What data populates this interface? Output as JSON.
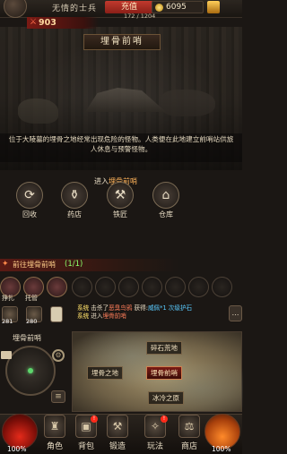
{
  "header": {
    "player_name": "无情的士兵",
    "vip_label": "充值",
    "coins": "6095",
    "hp_text": "172 / 1204",
    "power": "903"
  },
  "location": {
    "title": "埋骨前哨",
    "description": "位于大陵墓的埋骨之地经常出现危险的怪物。人类便在此地建立前哨站供旅人休息与预警怪物。"
  },
  "facilities": {
    "enter_prefix": "进入",
    "enter_name": "埋骨前哨",
    "items": [
      {
        "label": "回收",
        "icon": "recycle-icon"
      },
      {
        "label": "药店",
        "icon": "potion-icon"
      },
      {
        "label": "铁匠",
        "icon": "anvil-icon"
      },
      {
        "label": "仓库",
        "icon": "warehouse-icon"
      }
    ]
  },
  "quest": {
    "text": "前往埋骨前哨",
    "progress": "(1/1)"
  },
  "skills": {
    "labels": [
      "挣扎",
      "托管"
    ]
  },
  "items": [
    {
      "count": "281"
    },
    {
      "count": "280"
    }
  ],
  "log": [
    {
      "tag": "系统",
      "text1": "击杀了",
      "name": "恶臭鸟鸦",
      "text2": " 获得:",
      "item": "威佩*1",
      "text3": " 次级护石"
    },
    {
      "tag": "系统",
      "text1": "进入",
      "name": "埋骨前哨",
      "text2": "",
      "item": "",
      "text3": ""
    }
  ],
  "map": {
    "current_area": "埋骨前哨",
    "labels": [
      "碎石荒地",
      "埋骨之地",
      "埋骨前哨",
      "冰冷之原"
    ]
  },
  "bottom_nav": {
    "hp_pct": "100%",
    "mp_pct": "100%",
    "items": [
      "角色",
      "背包",
      "锻造",
      "玩法",
      "商店"
    ]
  }
}
